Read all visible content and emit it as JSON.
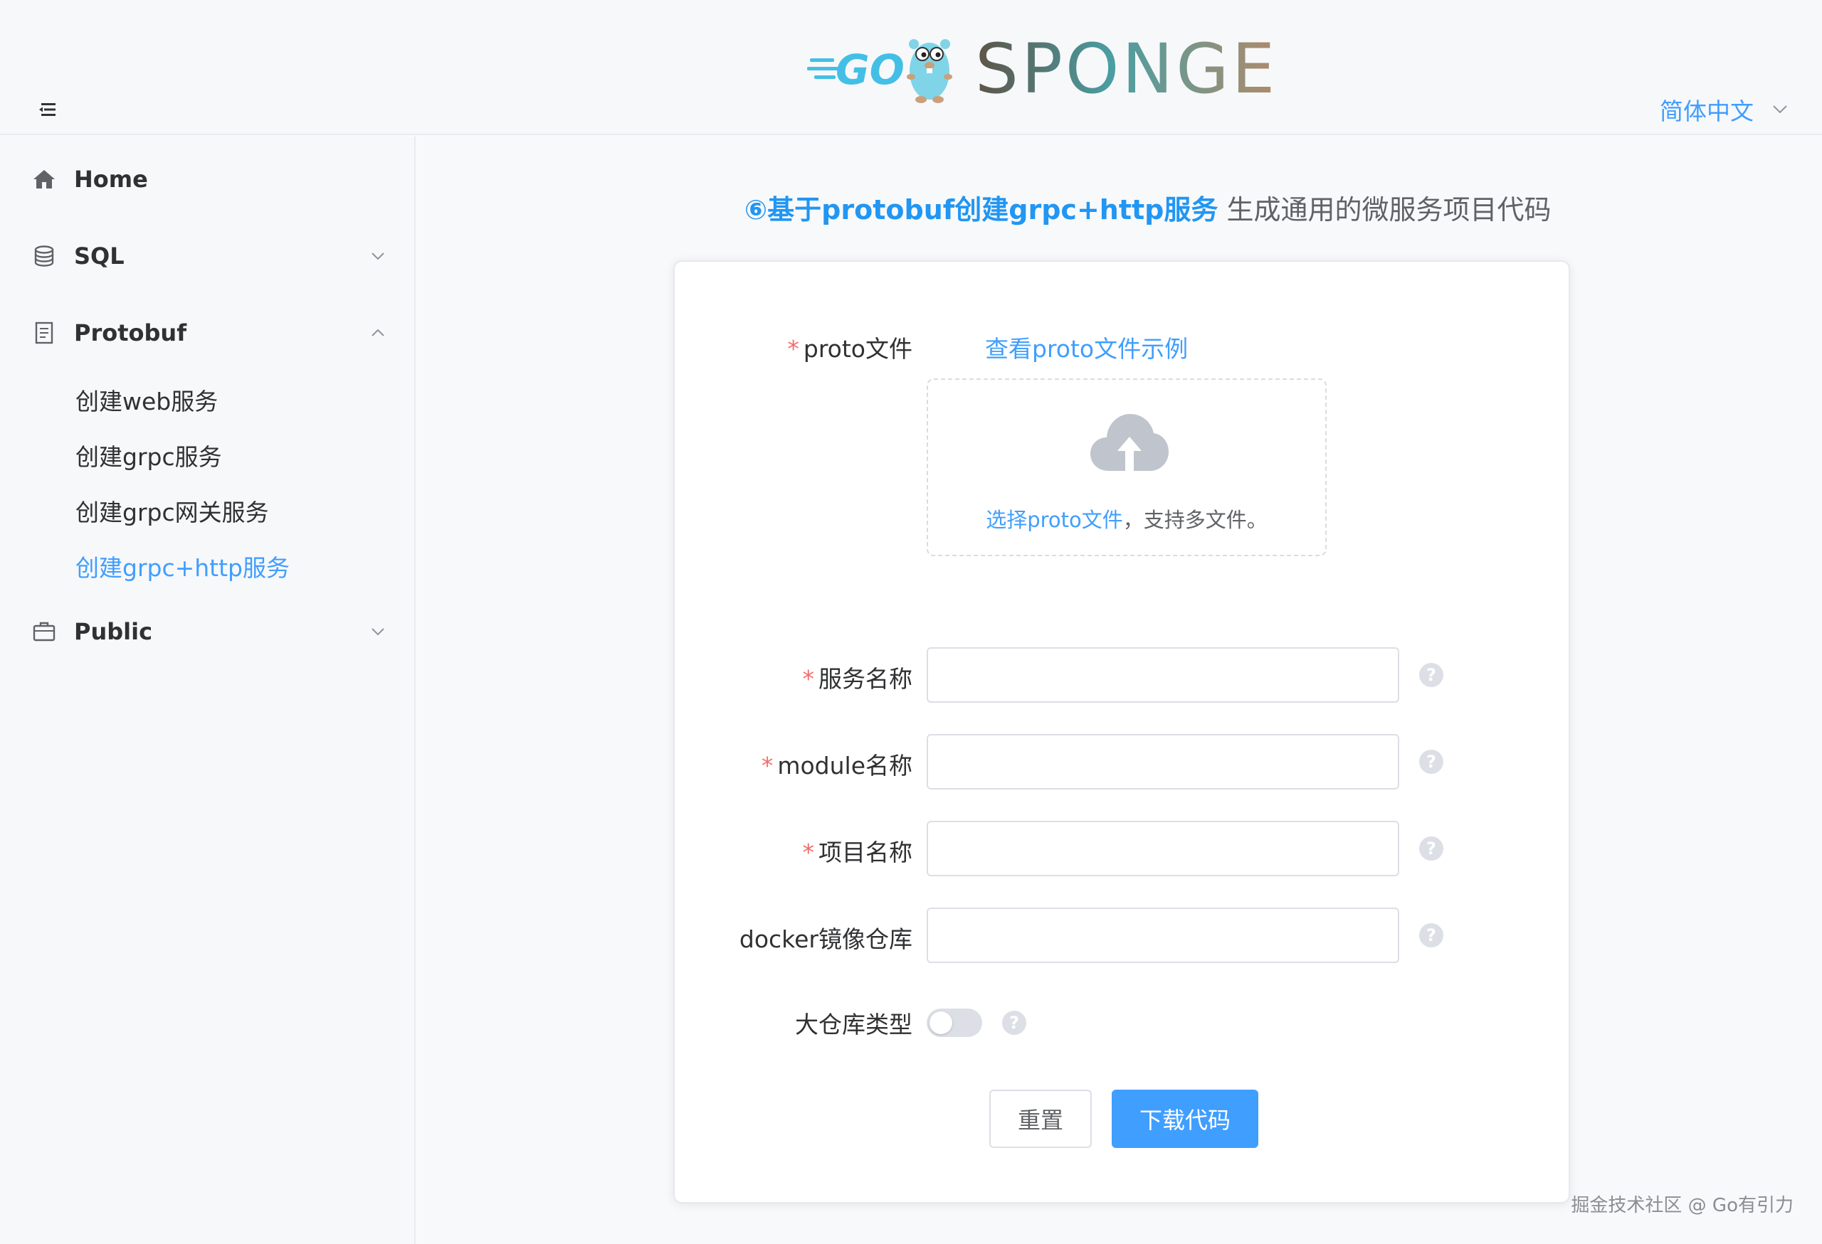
{
  "header": {
    "logo_go": "GO",
    "logo_sponge": "SPONGE",
    "language": "简体中文"
  },
  "sidebar": {
    "items": [
      {
        "label": "Home",
        "icon": "home-icon"
      },
      {
        "label": "SQL",
        "icon": "database-icon"
      },
      {
        "label": "Protobuf",
        "icon": "document-icon"
      },
      {
        "label": "Public",
        "icon": "briefcase-icon"
      }
    ],
    "protobuf_sub": [
      {
        "label": "创建web服务"
      },
      {
        "label": "创建grpc服务"
      },
      {
        "label": "创建grpc网关服务"
      },
      {
        "label": "创建grpc+http服务"
      }
    ]
  },
  "main": {
    "title_highlight": "⑥基于protobuf创建grpc+http服务",
    "title_sub": " 生成通用的微服务项目代码"
  },
  "form": {
    "proto_label": "proto文件",
    "proto_example_link": "查看proto文件示例",
    "upload_link": "选择proto文件",
    "upload_hint": "，支持多文件。",
    "service_name_label": "服务名称",
    "module_name_label": "module名称",
    "project_name_label": "项目名称",
    "docker_label": "docker镜像仓库",
    "monorepo_label": "大仓库类型",
    "required_mark": "*",
    "help_glyph": "?",
    "reset_button": "重置",
    "download_button": "下载代码"
  },
  "watermark": "掘金技术社区 @ Go有引力",
  "colors": {
    "accent": "#409eff",
    "title_blue": "#2196f3",
    "required": "#f56c6c"
  }
}
